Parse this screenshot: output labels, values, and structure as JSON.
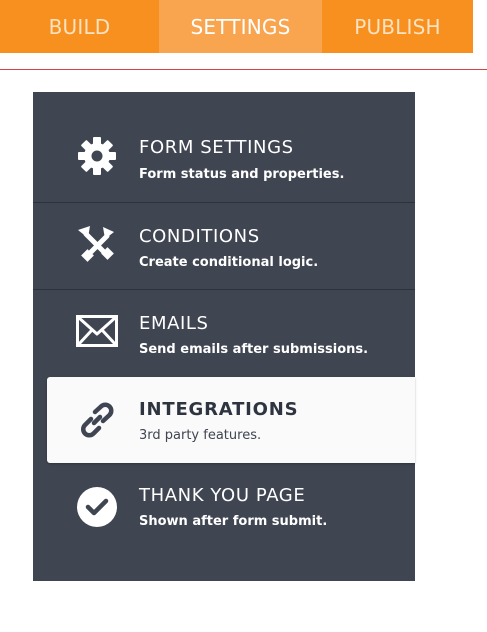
{
  "tabs": {
    "build": "BUILD",
    "settings": "SETTINGS",
    "publish": "PUBLISH"
  },
  "menu": {
    "form_settings": {
      "title": "FORM SETTINGS",
      "subtitle": "Form status and properties.",
      "icon": "gear-icon"
    },
    "conditions": {
      "title": "CONDITIONS",
      "subtitle": "Create conditional logic.",
      "icon": "conditions-icon"
    },
    "emails": {
      "title": "EMAILS",
      "subtitle": "Send emails after submissions.",
      "icon": "envelope-icon"
    },
    "integrations": {
      "title": "INTEGRATIONS",
      "subtitle": "3rd party features.",
      "icon": "link-icon"
    },
    "thank_you": {
      "title": "THANK YOU PAGE",
      "subtitle": "Shown after form submit.",
      "icon": "checkmark-circle-icon"
    }
  },
  "colors": {
    "accent": "#f7901e",
    "panel": "#3f4551",
    "active_bg": "#fafafa",
    "divider": "#d9404b"
  }
}
